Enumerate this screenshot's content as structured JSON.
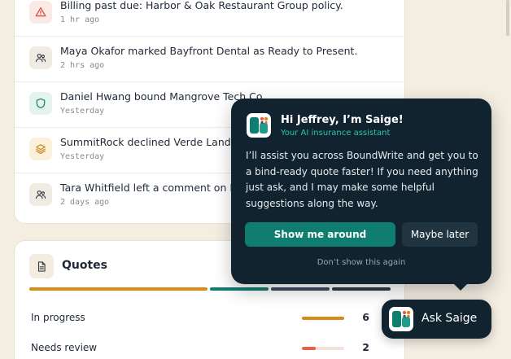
{
  "activity": {
    "items": [
      {
        "icon": "alert-triangle-icon",
        "text": "Billing past due: Harbor & Oak Restaurant Group policy.",
        "time": "1 hr ago"
      },
      {
        "icon": "users-icon",
        "text": "Maya Okafor marked Bayfront Dental as Ready to Present.",
        "time": "2 hrs ago"
      },
      {
        "icon": "shield-icon",
        "text": "Daniel Hwang bound Mangrove Tech Co",
        "time": "Yesterday"
      },
      {
        "icon": "layers-icon",
        "text": "SummitRock declined Verde Landscap",
        "time": "Yesterday"
      },
      {
        "icon": "users-icon",
        "text": "Tara Whitfield left a comment on Pine",
        "time": "2 days ago"
      }
    ]
  },
  "quotes": {
    "title": "Quotes",
    "icon": "document-icon",
    "segment_colors": [
      "#d98a17",
      "#0f7d70",
      "#3a4a6b",
      "#2a3a4a"
    ],
    "rows": [
      {
        "label": "In progress",
        "count": "6",
        "fraction": 1.0,
        "color": "#d98a17"
      },
      {
        "label": "Needs review",
        "count": "2",
        "fraction": 0.33,
        "color": "#e8604a"
      }
    ]
  },
  "popup": {
    "title": "Hi Jeffrey, I’m Saige!",
    "subtitle": "Your AI insurance assistant",
    "body": "I’ll assist you across BoundWrite and get you to a bind-ready quote faster! If you need anything just ask, and I may make some helpful suggestions along the way.",
    "primary_button": "Show me around",
    "secondary_button": "Maybe later",
    "dismiss_link": "Don’t show this again"
  },
  "ask_saige": {
    "label": "Ask Saige"
  },
  "colors": {
    "background": "#f3ede2",
    "navy": "#10232e",
    "teal": "#0f7d70",
    "teal_light": "#2bc4ad",
    "amber": "#d98a17",
    "red": "#e8604a"
  }
}
